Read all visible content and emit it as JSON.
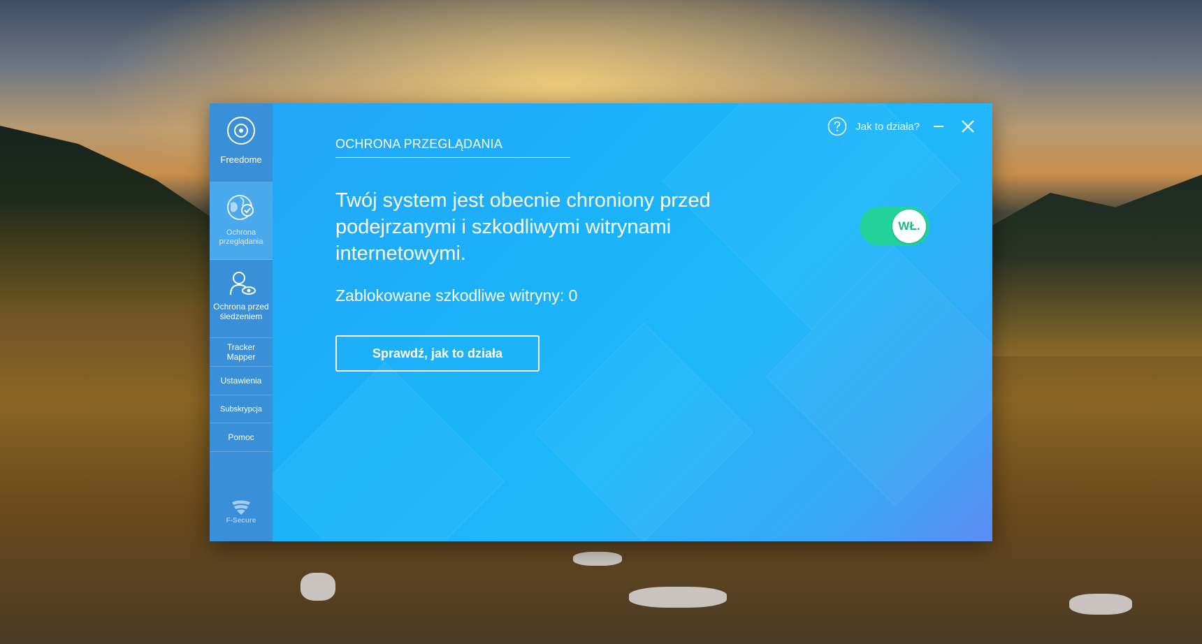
{
  "sidebar": {
    "items": [
      {
        "label": "Freedome",
        "icon": "freedome-icon"
      },
      {
        "label": "Ochrona przeglądania",
        "icon": "globe-shield-icon"
      },
      {
        "label": "Ochrona przed śledzeniem",
        "icon": "user-eye-icon"
      },
      {
        "label": "Tracker Mapper"
      },
      {
        "label": "Ustawienia"
      },
      {
        "label": "Subskrypcja"
      },
      {
        "label": "Pomoc"
      }
    ],
    "logo_text": "F-Secure"
  },
  "header": {
    "help_label": "Jak to działa?"
  },
  "main": {
    "section_title": "OCHRONA PRZEGLĄDANIA",
    "headline": "Twój system jest obecnie chroniony przed podejrzanymi i szkodliwymi witrynami internetowymi.",
    "blocked_label": "Zablokowane szkodliwe witryny: 0",
    "check_button": "Sprawdź, jak to działa",
    "toggle_label": "WŁ.",
    "toggle_state": "on"
  },
  "colors": {
    "sidebar_bg": "#3a8fd9",
    "sidebar_active": "#4aa8ec",
    "main_bg": "#1bb3f8",
    "toggle_on": "#23d29a"
  }
}
